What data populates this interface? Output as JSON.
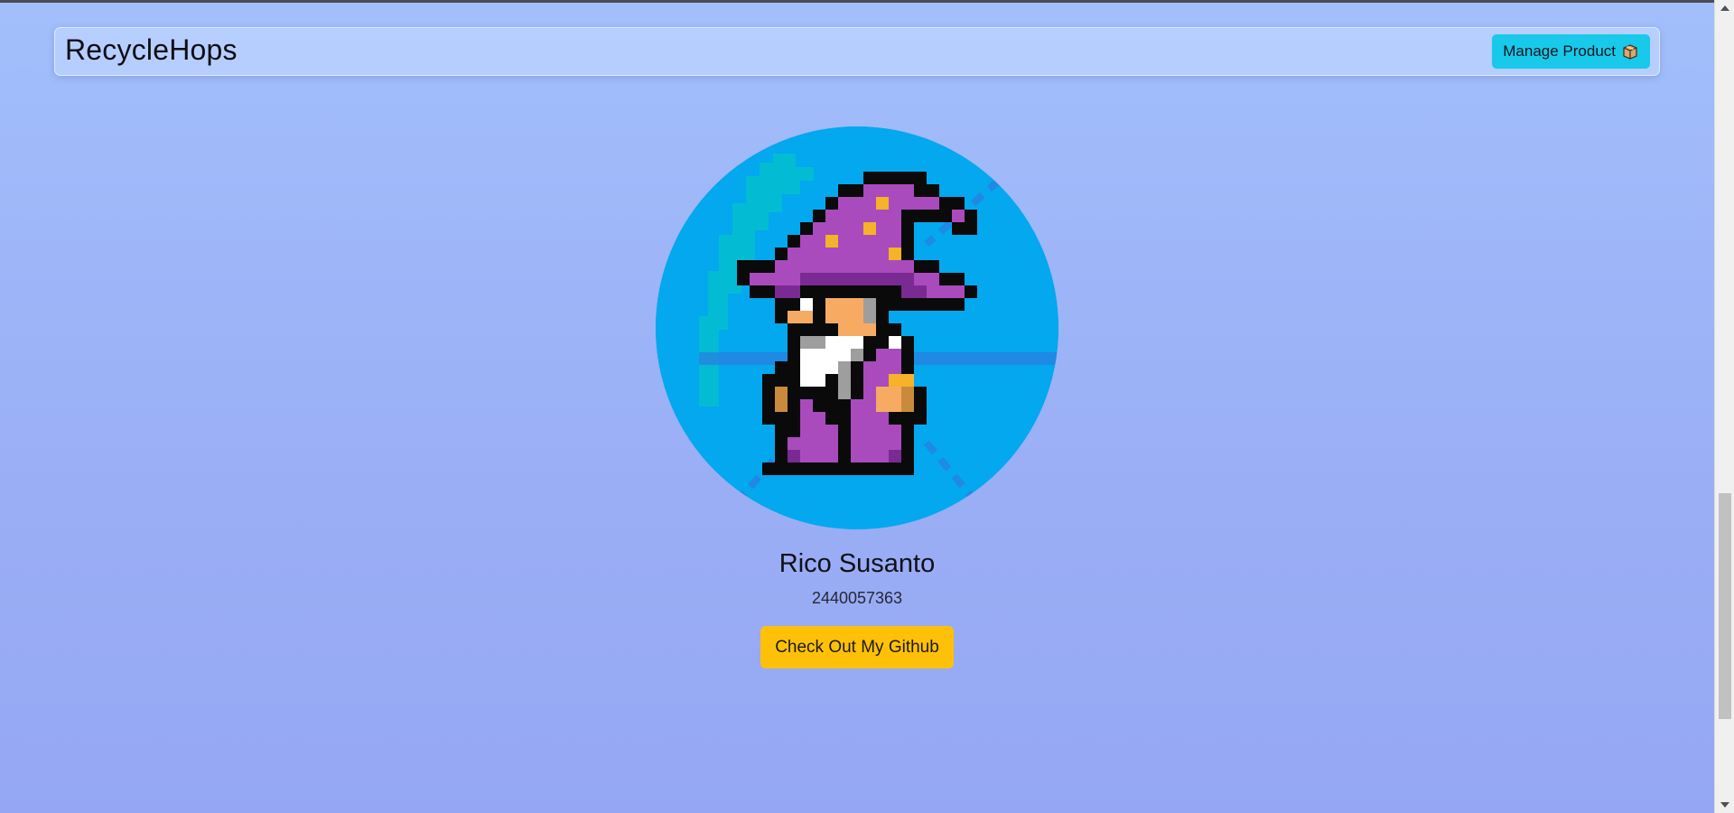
{
  "navbar": {
    "brand": "RecycleHops",
    "manage_button": {
      "label": "Manage Product",
      "icon": "package-box-icon"
    }
  },
  "profile": {
    "avatar": "pixel-wizard-avatar",
    "name": "Rico Susanto",
    "student_id": "2440057363",
    "github_button": "Check Out My Github"
  },
  "colors": {
    "accent_cyan": "#18c9ea",
    "button_yellow": "#ffc107",
    "avatar_bg": "#03a8ef",
    "wizard_purple": "#a94bbd"
  }
}
